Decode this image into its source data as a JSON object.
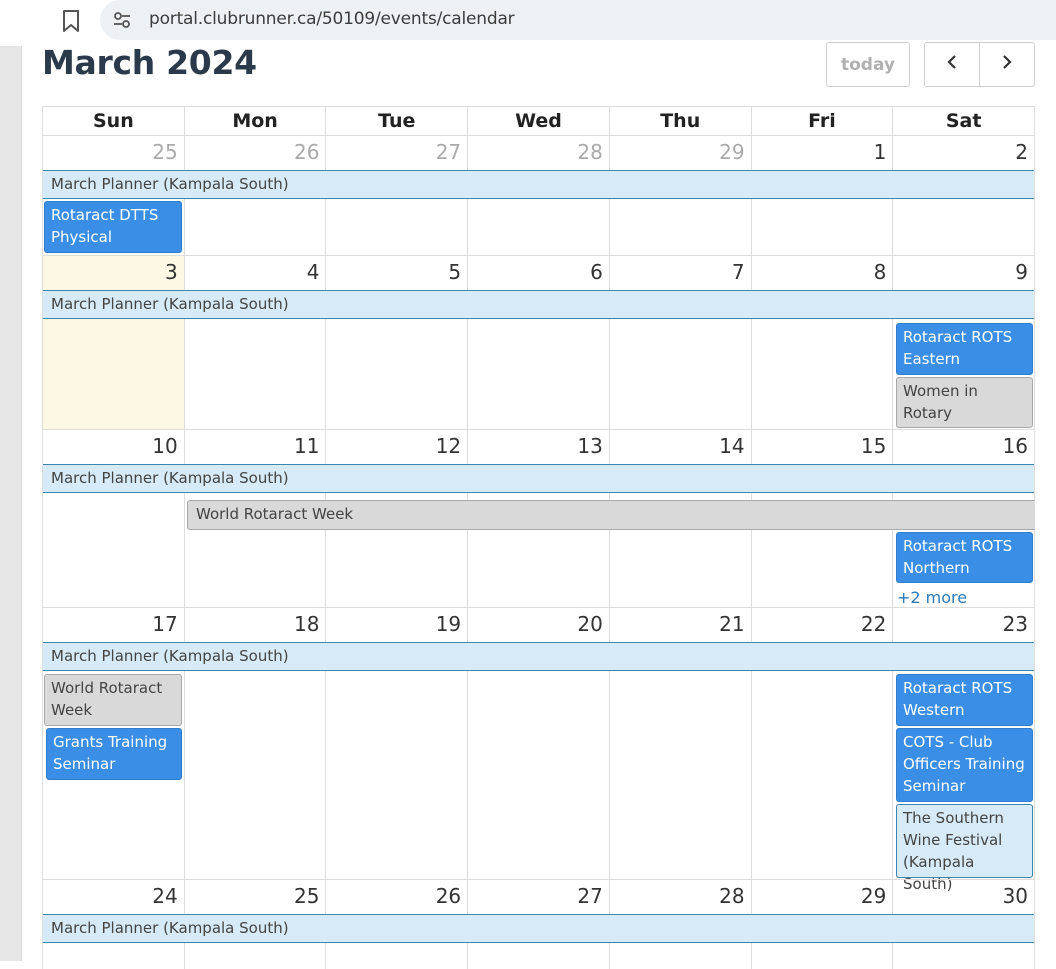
{
  "browser": {
    "url": "portal.clubrunner.ca/50109/events/calendar"
  },
  "calendar": {
    "title": "March 2024",
    "today_label": "today",
    "weekdays": [
      "Sun",
      "Mon",
      "Tue",
      "Wed",
      "Thu",
      "Fri",
      "Sat"
    ],
    "weeks": [
      {
        "days": [
          "25",
          "26",
          "27",
          "28",
          "29",
          "1",
          "2"
        ],
        "planner": "March Planner (Kampala South)",
        "events": [
          {
            "day": "Sun",
            "title": "Rotaract DTTS Physical",
            "lines": [
              "Rotaract DTTS",
              "Physical"
            ],
            "style": "blue"
          }
        ]
      },
      {
        "days": [
          "3",
          "4",
          "5",
          "6",
          "7",
          "8",
          "9"
        ],
        "planner": "March Planner (Kampala South)",
        "events": [
          {
            "day": "Sat",
            "lines": [
              "Rotaract ROTS",
              "Eastern"
            ],
            "style": "blue"
          },
          {
            "day": "Sat",
            "lines": [
              "Women in",
              "Rotary"
            ],
            "style": "gray"
          }
        ]
      },
      {
        "days": [
          "10",
          "11",
          "12",
          "13",
          "14",
          "15",
          "16"
        ],
        "planner": "March Planner (Kampala South)",
        "events": [
          {
            "day": "Mon-Sat",
            "lines": [
              "World Rotaract Week"
            ],
            "style": "gray"
          },
          {
            "day": "Sat",
            "lines": [
              "Rotaract ROTS",
              "Northern"
            ],
            "style": "blue"
          }
        ],
        "more": "+2 more"
      },
      {
        "days": [
          "17",
          "18",
          "19",
          "20",
          "21",
          "22",
          "23"
        ],
        "planner": "March Planner (Kampala South)",
        "events": [
          {
            "day": "Sun",
            "lines": [
              "World Rotaract",
              "Week"
            ],
            "style": "gray"
          },
          {
            "day": "Sun",
            "lines": [
              "Grants Training",
              "Seminar"
            ],
            "style": "blue"
          },
          {
            "day": "Sat",
            "lines": [
              "Rotaract ROTS",
              "Western"
            ],
            "style": "blue"
          },
          {
            "day": "Sat",
            "lines": [
              "COTS - Club",
              "Officers Training",
              "Seminar"
            ],
            "style": "blue"
          },
          {
            "day": "Sat",
            "lines": [
              "The Southern",
              "Wine Festival",
              "(Kampala South)"
            ],
            "style": "lightblue"
          }
        ]
      },
      {
        "days": [
          "24",
          "25",
          "26",
          "27",
          "28",
          "29",
          "30"
        ],
        "planner": "March Planner (Kampala South)",
        "events": []
      }
    ]
  },
  "colors": {
    "event_blue": "#3a8ee6",
    "event_gray": "#d9d9d9",
    "planner_bg": "#d6eaf8",
    "today_bg": "#fcf8e3",
    "link": "#2c7ab8"
  },
  "icons": {
    "bookmark": "bookmark-icon",
    "site_settings": "tune-icon",
    "prev": "chevron-left-icon",
    "next": "chevron-right-icon"
  }
}
